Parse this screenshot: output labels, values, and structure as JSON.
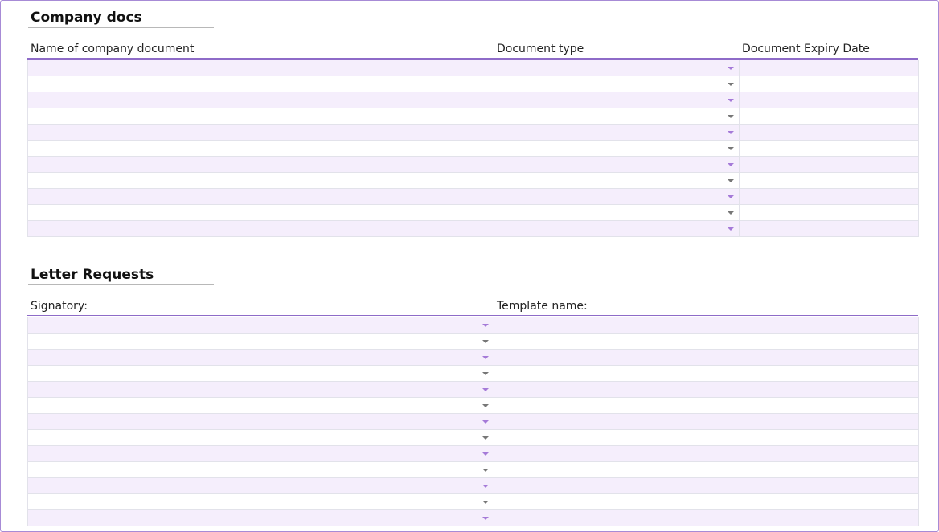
{
  "company_docs": {
    "title": "Company docs",
    "columns": [
      "Name of company document",
      "Document type",
      "Document Expiry Date"
    ],
    "row_count": 11
  },
  "letter_requests": {
    "title": "Letter Requests",
    "columns": [
      "Signatory:",
      "Template name:"
    ],
    "row_count": 13
  },
  "icons": {
    "dropdown": "dropdown-arrow-icon"
  },
  "colors": {
    "accent": "#8e6bc8",
    "band": "#f5eefc",
    "frame": "#a78bd6"
  }
}
